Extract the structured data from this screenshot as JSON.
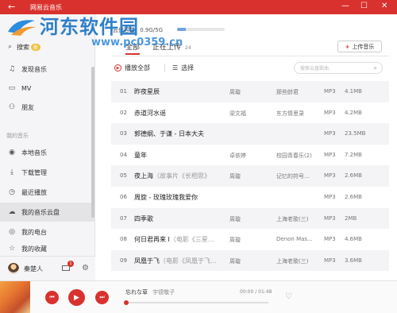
{
  "app": {
    "title": "网易云音乐"
  },
  "window": {
    "back": "←",
    "minimize": "—",
    "maximize": "☐",
    "close": "✕"
  },
  "watermark": {
    "title": "河东软件园",
    "url": "www.pc0359.cn"
  },
  "sidebar": {
    "search_item": {
      "label": "搜索",
      "badge": "新"
    },
    "items": [
      {
        "label": "发现音乐",
        "icon": "music-note-icon"
      },
      {
        "label": "MV",
        "icon": "video-icon"
      },
      {
        "label": "朋友",
        "icon": "friends-icon"
      }
    ],
    "section_title": "我的音乐",
    "my_items": [
      {
        "label": "本地音乐",
        "icon": "disc-icon"
      },
      {
        "label": "下载管理",
        "icon": "download-icon"
      },
      {
        "label": "最近播放",
        "icon": "clock-icon"
      },
      {
        "label": "我的音乐云盘",
        "icon": "cloud-icon"
      },
      {
        "label": "我的电台",
        "icon": "radio-icon"
      },
      {
        "label": "我的收藏",
        "icon": "star-icon"
      }
    ],
    "user": {
      "name": "秦楚人",
      "mail_badge": "1"
    }
  },
  "main": {
    "cloud_capacity": {
      "label": "云盘容量",
      "value": "0.9G/5G",
      "fraction": 0.18
    },
    "tabs": [
      {
        "label": "全部",
        "count": ""
      },
      {
        "label": "正在上传",
        "count": "24"
      }
    ],
    "upload_button": "上传音乐",
    "play_all": "播放全部",
    "select": "选择",
    "search_placeholder": "搜索云盘歌曲"
  },
  "songs": [
    {
      "num": "01",
      "title": "昨夜星辰",
      "subtitle": "",
      "artist": "周璇",
      "album": "那些龄君",
      "format": "MP3",
      "size": "4.1MB"
    },
    {
      "num": "02",
      "title": "赤道河水谣",
      "subtitle": "",
      "artist": "梁文福",
      "album": "东方情思录",
      "format": "MP3",
      "size": "4.2MB"
    },
    {
      "num": "03",
      "title": "郭德纲、于谦 - 日本大夫",
      "subtitle": "",
      "artist": "",
      "album": "",
      "format": "MP3",
      "size": "23.5MB"
    },
    {
      "num": "04",
      "title": "童年",
      "subtitle": "",
      "artist": "卓依婷",
      "album": "校园青春乐(2)",
      "format": "MP3",
      "size": "7.2MB"
    },
    {
      "num": "05",
      "title": "夜上海",
      "subtitle": "（故事片《长相思》",
      "artist": "周璇",
      "album": "记忆的符号...",
      "format": "MP3",
      "size": "2.6MB"
    },
    {
      "num": "06",
      "title": "周旋 - 玫瑰玫瑰我爱你",
      "subtitle": "",
      "artist": "",
      "album": "",
      "format": "MP3",
      "size": "2.6MB"
    },
    {
      "num": "07",
      "title": "四季歌",
      "subtitle": "",
      "artist": "周璇",
      "album": "上海老歌(三)",
      "format": "MP3",
      "size": "2MB"
    },
    {
      "num": "08",
      "title": "何日君再来 I",
      "subtitle": "（电影《三星...",
      "artist": "周璇",
      "album": "Denon Mas...",
      "format": "MP3",
      "size": "4.6MB"
    },
    {
      "num": "09",
      "title": "凤凰于飞",
      "subtitle": "（电影《凤凰于飞...",
      "artist": "周璇",
      "album": "上海老歌(三)",
      "format": "MP3",
      "size": "3.6MB"
    }
  ],
  "player": {
    "song": "忘れな草",
    "artist": "宇德敬子",
    "time": "00:00 / 01:48",
    "progress_fraction": 0
  }
}
